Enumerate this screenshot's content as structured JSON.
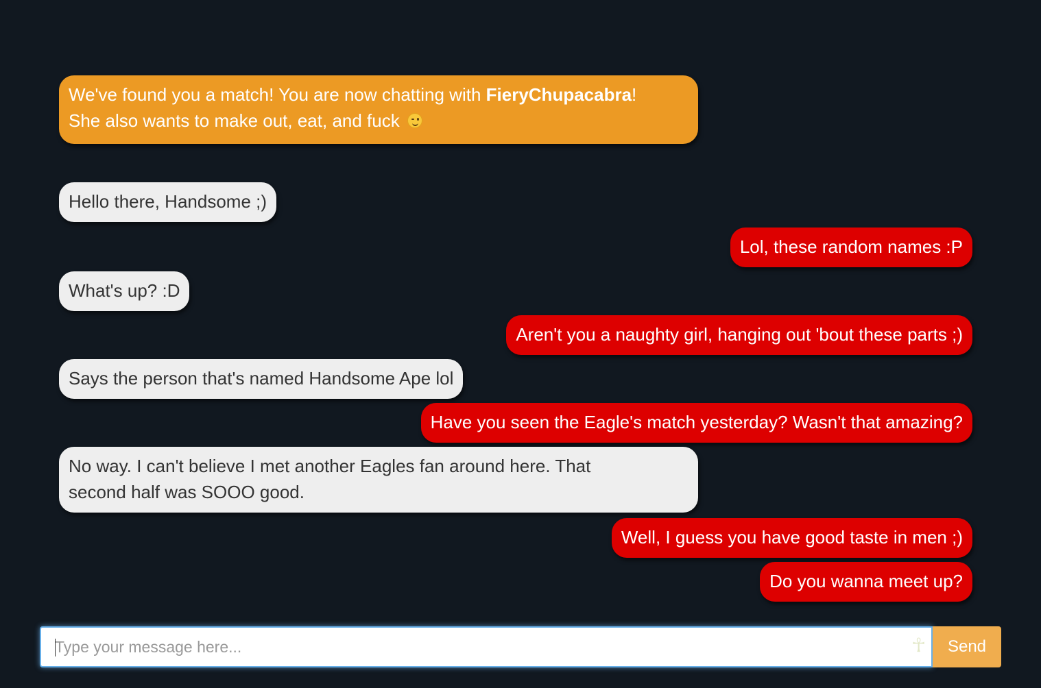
{
  "system_message": {
    "line1_prefix": "We've found you a match! You are now chatting with ",
    "match_name": "FieryChupacabra",
    "line1_suffix": "!",
    "line2": "She also wants to make out, eat, and fuck",
    "emoji": "winking-face-emoji"
  },
  "messages": [
    {
      "from": "them",
      "text": "Hello there, Handsome ;)"
    },
    {
      "from": "me",
      "text": "Lol, these random names :P"
    },
    {
      "from": "them",
      "text": "What's up? :D"
    },
    {
      "from": "me",
      "text": "Aren't you a naughty girl, hanging out 'bout these parts ;)"
    },
    {
      "from": "them",
      "text": "Says the person that's named Handsome Ape lol"
    },
    {
      "from": "me",
      "text": "Have you seen the Eagle's match yesterday? Wasn't that amazing?"
    },
    {
      "from": "them",
      "text": "No way. I can't believe I met another Eagles fan around here. That\nsecond half was SOOO good."
    },
    {
      "from": "me",
      "text": "Well, I guess you have good taste in men ;)"
    },
    {
      "from": "me",
      "text": "Do you wanna meet up?"
    }
  ],
  "composer": {
    "placeholder": "Type your message here...",
    "value": "",
    "send_label": "Send",
    "extension_icon": "ankh-icon"
  },
  "colors": {
    "background": "#111820",
    "system_bubble": "#ec9a24",
    "their_bubble": "#eeeeee",
    "my_bubble": "#dd0000",
    "send_button": "#f0ad4e",
    "input_focus_border": "#66afe9"
  }
}
